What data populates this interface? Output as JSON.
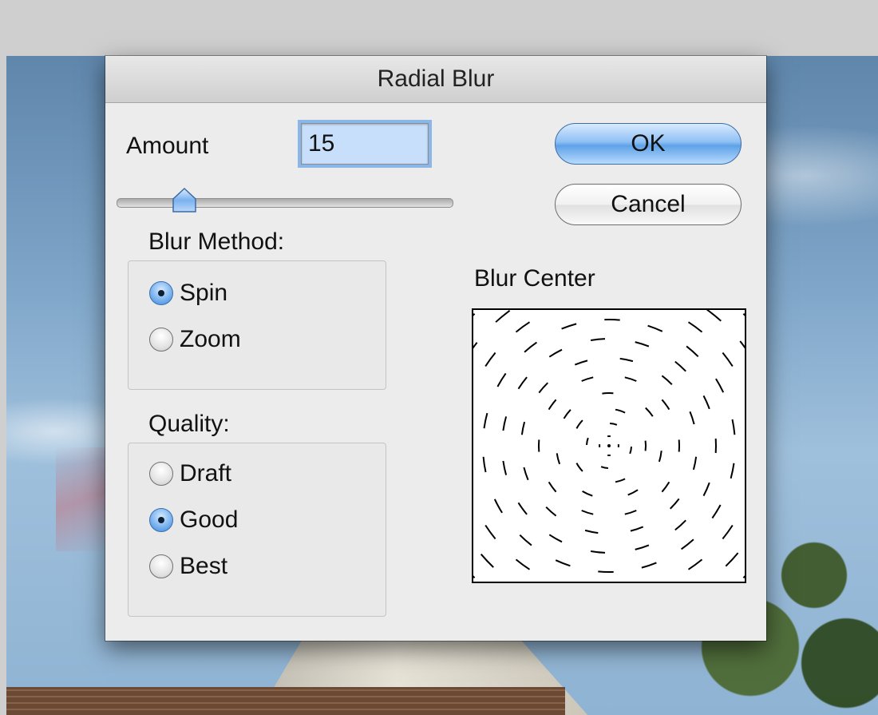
{
  "dialog": {
    "title": "Radial Blur",
    "amount_label": "Amount",
    "amount_value": "15",
    "slider_level": 0.15,
    "ok_label": "OK",
    "cancel_label": "Cancel",
    "blur_method": {
      "heading": "Blur Method:",
      "options": [
        {
          "label": "Spin",
          "checked": true
        },
        {
          "label": "Zoom",
          "checked": false
        }
      ]
    },
    "quality": {
      "heading": "Quality:",
      "options": [
        {
          "label": "Draft",
          "checked": false
        },
        {
          "label": "Good",
          "checked": true
        },
        {
          "label": "Best",
          "checked": false
        }
      ]
    },
    "blur_center_label": "Blur Center"
  },
  "colors": {
    "accent": "#5fa2e8",
    "input_bg": "#c7dffb",
    "dialog_bg": "#ececec"
  }
}
